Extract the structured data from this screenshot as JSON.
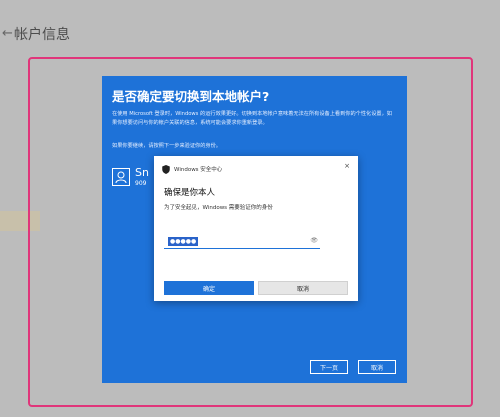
{
  "settings_page": {
    "back_glyph": "←",
    "title": "帐户信息"
  },
  "switch_dialog": {
    "title": "是否确定要切换到本地帐户?",
    "description": "在使用 Microsoft 登录时，Windows 的运行效果更好。切换到本地帐户意味着无法在所有设备上看到你的个性化设置，如果你想要访问与你的帐户关联的信息，系统可能会要求你重新登录。",
    "hint": "如果你要继续，请按照下一步来验证你的身份。",
    "account_name": "Sn",
    "account_sub": "909",
    "next_label": "下一页",
    "cancel_label": "取消"
  },
  "security_dialog": {
    "header_title": "Windows 安全中心",
    "title": "确保是你本人",
    "subtitle": "为了安全起见，Windows 需要验证你的身份",
    "pin_value": "●●●●●",
    "ok_label": "确定",
    "cancel_label": "取消"
  },
  "colors": {
    "dialog_blue": "#1e72d8",
    "highlight_frame": "#e0357a"
  }
}
